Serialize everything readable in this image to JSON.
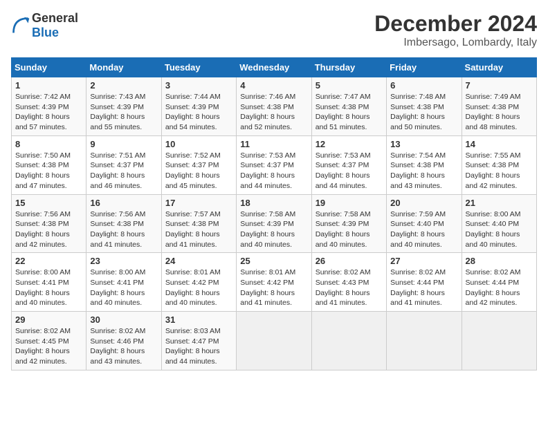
{
  "header": {
    "logo_general": "General",
    "logo_blue": "Blue",
    "title": "December 2024",
    "subtitle": "Imbersago, Lombardy, Italy"
  },
  "weekdays": [
    "Sunday",
    "Monday",
    "Tuesday",
    "Wednesday",
    "Thursday",
    "Friday",
    "Saturday"
  ],
  "weeks": [
    [
      {
        "day": "1",
        "rise": "Sunrise: 7:42 AM",
        "set": "Sunset: 4:39 PM",
        "light": "Daylight: 8 hours and 57 minutes."
      },
      {
        "day": "2",
        "rise": "Sunrise: 7:43 AM",
        "set": "Sunset: 4:39 PM",
        "light": "Daylight: 8 hours and 55 minutes."
      },
      {
        "day": "3",
        "rise": "Sunrise: 7:44 AM",
        "set": "Sunset: 4:39 PM",
        "light": "Daylight: 8 hours and 54 minutes."
      },
      {
        "day": "4",
        "rise": "Sunrise: 7:46 AM",
        "set": "Sunset: 4:38 PM",
        "light": "Daylight: 8 hours and 52 minutes."
      },
      {
        "day": "5",
        "rise": "Sunrise: 7:47 AM",
        "set": "Sunset: 4:38 PM",
        "light": "Daylight: 8 hours and 51 minutes."
      },
      {
        "day": "6",
        "rise": "Sunrise: 7:48 AM",
        "set": "Sunset: 4:38 PM",
        "light": "Daylight: 8 hours and 50 minutes."
      },
      {
        "day": "7",
        "rise": "Sunrise: 7:49 AM",
        "set": "Sunset: 4:38 PM",
        "light": "Daylight: 8 hours and 48 minutes."
      }
    ],
    [
      {
        "day": "8",
        "rise": "Sunrise: 7:50 AM",
        "set": "Sunset: 4:38 PM",
        "light": "Daylight: 8 hours and 47 minutes."
      },
      {
        "day": "9",
        "rise": "Sunrise: 7:51 AM",
        "set": "Sunset: 4:37 PM",
        "light": "Daylight: 8 hours and 46 minutes."
      },
      {
        "day": "10",
        "rise": "Sunrise: 7:52 AM",
        "set": "Sunset: 4:37 PM",
        "light": "Daylight: 8 hours and 45 minutes."
      },
      {
        "day": "11",
        "rise": "Sunrise: 7:53 AM",
        "set": "Sunset: 4:37 PM",
        "light": "Daylight: 8 hours and 44 minutes."
      },
      {
        "day": "12",
        "rise": "Sunrise: 7:53 AM",
        "set": "Sunset: 4:37 PM",
        "light": "Daylight: 8 hours and 44 minutes."
      },
      {
        "day": "13",
        "rise": "Sunrise: 7:54 AM",
        "set": "Sunset: 4:38 PM",
        "light": "Daylight: 8 hours and 43 minutes."
      },
      {
        "day": "14",
        "rise": "Sunrise: 7:55 AM",
        "set": "Sunset: 4:38 PM",
        "light": "Daylight: 8 hours and 42 minutes."
      }
    ],
    [
      {
        "day": "15",
        "rise": "Sunrise: 7:56 AM",
        "set": "Sunset: 4:38 PM",
        "light": "Daylight: 8 hours and 42 minutes."
      },
      {
        "day": "16",
        "rise": "Sunrise: 7:56 AM",
        "set": "Sunset: 4:38 PM",
        "light": "Daylight: 8 hours and 41 minutes."
      },
      {
        "day": "17",
        "rise": "Sunrise: 7:57 AM",
        "set": "Sunset: 4:38 PM",
        "light": "Daylight: 8 hours and 41 minutes."
      },
      {
        "day": "18",
        "rise": "Sunrise: 7:58 AM",
        "set": "Sunset: 4:39 PM",
        "light": "Daylight: 8 hours and 40 minutes."
      },
      {
        "day": "19",
        "rise": "Sunrise: 7:58 AM",
        "set": "Sunset: 4:39 PM",
        "light": "Daylight: 8 hours and 40 minutes."
      },
      {
        "day": "20",
        "rise": "Sunrise: 7:59 AM",
        "set": "Sunset: 4:40 PM",
        "light": "Daylight: 8 hours and 40 minutes."
      },
      {
        "day": "21",
        "rise": "Sunrise: 8:00 AM",
        "set": "Sunset: 4:40 PM",
        "light": "Daylight: 8 hours and 40 minutes."
      }
    ],
    [
      {
        "day": "22",
        "rise": "Sunrise: 8:00 AM",
        "set": "Sunset: 4:41 PM",
        "light": "Daylight: 8 hours and 40 minutes."
      },
      {
        "day": "23",
        "rise": "Sunrise: 8:00 AM",
        "set": "Sunset: 4:41 PM",
        "light": "Daylight: 8 hours and 40 minutes."
      },
      {
        "day": "24",
        "rise": "Sunrise: 8:01 AM",
        "set": "Sunset: 4:42 PM",
        "light": "Daylight: 8 hours and 40 minutes."
      },
      {
        "day": "25",
        "rise": "Sunrise: 8:01 AM",
        "set": "Sunset: 4:42 PM",
        "light": "Daylight: 8 hours and 41 minutes."
      },
      {
        "day": "26",
        "rise": "Sunrise: 8:02 AM",
        "set": "Sunset: 4:43 PM",
        "light": "Daylight: 8 hours and 41 minutes."
      },
      {
        "day": "27",
        "rise": "Sunrise: 8:02 AM",
        "set": "Sunset: 4:44 PM",
        "light": "Daylight: 8 hours and 41 minutes."
      },
      {
        "day": "28",
        "rise": "Sunrise: 8:02 AM",
        "set": "Sunset: 4:44 PM",
        "light": "Daylight: 8 hours and 42 minutes."
      }
    ],
    [
      {
        "day": "29",
        "rise": "Sunrise: 8:02 AM",
        "set": "Sunset: 4:45 PM",
        "light": "Daylight: 8 hours and 42 minutes."
      },
      {
        "day": "30",
        "rise": "Sunrise: 8:02 AM",
        "set": "Sunset: 4:46 PM",
        "light": "Daylight: 8 hours and 43 minutes."
      },
      {
        "day": "31",
        "rise": "Sunrise: 8:03 AM",
        "set": "Sunset: 4:47 PM",
        "light": "Daylight: 8 hours and 44 minutes."
      },
      null,
      null,
      null,
      null
    ]
  ]
}
